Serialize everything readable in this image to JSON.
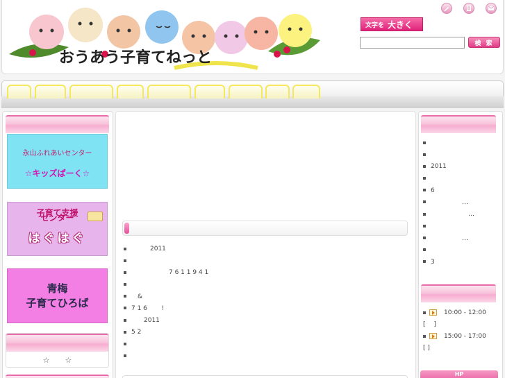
{
  "header": {
    "logo_alt": "おうあう子育てねっと",
    "font_size_button": {
      "prefix": "文字を",
      "big": "大きく"
    },
    "search": {
      "value": "",
      "placeholder": ""
    },
    "search_button": "検 索",
    "util_icons": [
      "pencil-icon",
      "sitemap-icon",
      "mail-icon"
    ]
  },
  "nav": {
    "tab_count": 9
  },
  "left": {
    "banners": [
      {
        "line1": "永山ふれあいセンター",
        "line2": "☆キッズぱーく☆"
      },
      {
        "line1": "子育て支援",
        "line2": "センター",
        "line3": "はぐはぐ"
      },
      {
        "line1": "青梅",
        "line2": "子育てひろば"
      }
    ],
    "stars": "☆　　☆"
  },
  "center": {
    "news": [
      "　　　2011",
      "",
      "　　　　　　7 6 1  1 9 4 1",
      "",
      "　&",
      "7 1 6 　　!",
      "　　2011",
      "5 2",
      "",
      ""
    ]
  },
  "right": {
    "list1": [
      "",
      "",
      "2011",
      "",
      "6",
      "　　　　　…",
      "　　　　　　…",
      "",
      "　　　　　…",
      "",
      "3"
    ],
    "schedule": [
      {
        "time": "10:00 - 12:00",
        "bracket": "[ 　]"
      },
      {
        "time": "15:00 - 17:00",
        "bracket": "[ ]"
      }
    ],
    "hp_label": "HP"
  },
  "colors": {
    "accent_pink": "#e0237a",
    "nav_tab_border": "#f5e85a",
    "banner_cyan": "#7fe3f3",
    "banner_lilac": "#e7b5ec",
    "banner_magenta": "#f37ee4"
  }
}
